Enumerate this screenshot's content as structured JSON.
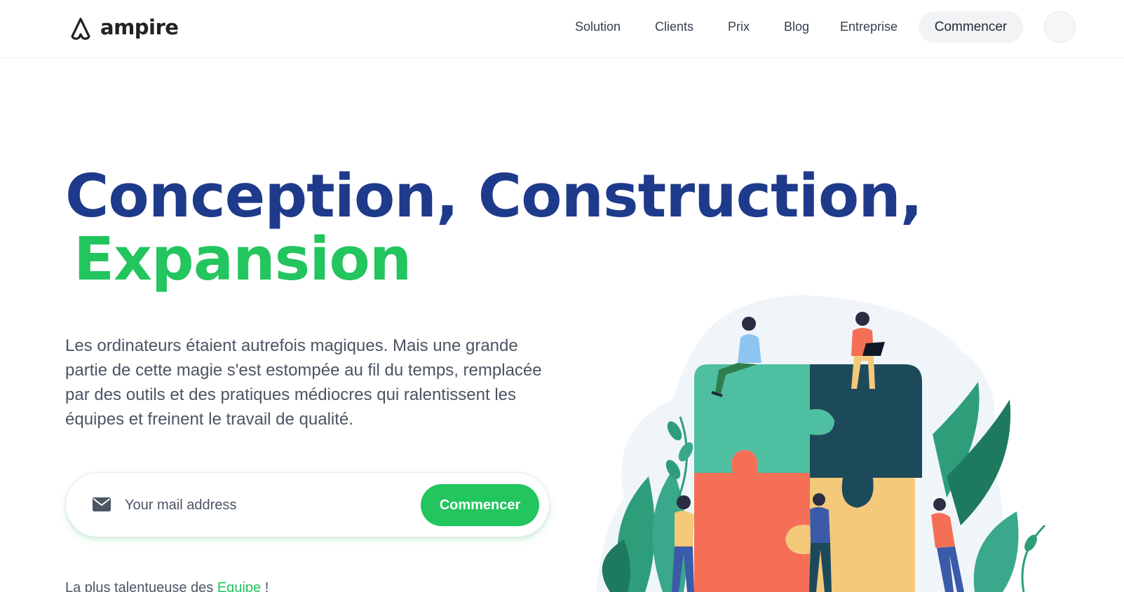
{
  "brand": {
    "name": "ampire",
    "logo_icon": "ampire-logo-icon"
  },
  "nav": {
    "links": [
      "Solution",
      "Clients",
      "Prix",
      "Blog",
      "Entreprise"
    ],
    "cta_label": "Commencer"
  },
  "hero": {
    "title_line1": "Conception, Construction,",
    "title_line2": "Expansion",
    "description": "Les ordinateurs étaient autrefois magiques. Mais une grande partie de cette magie s'est estompée au fil du temps, remplacée par des outils et des pratiques médiocres qui ralentissent les équipes et freinent le travail de qualité."
  },
  "signup": {
    "placeholder": "Your mail address",
    "button_label": "Commencer",
    "icon": "mail-icon"
  },
  "tagline": {
    "prefix": "La plus talentueuse des",
    "link": "Equipe",
    "suffix": "!"
  },
  "colors": {
    "primary": "#1e3a8a",
    "accent": "#22c55e",
    "puzzle_teal": "#4fbfa2",
    "puzzle_dark": "#1d4a5a",
    "puzzle_coral": "#f46f55",
    "puzzle_yellow": "#f5c97a"
  }
}
